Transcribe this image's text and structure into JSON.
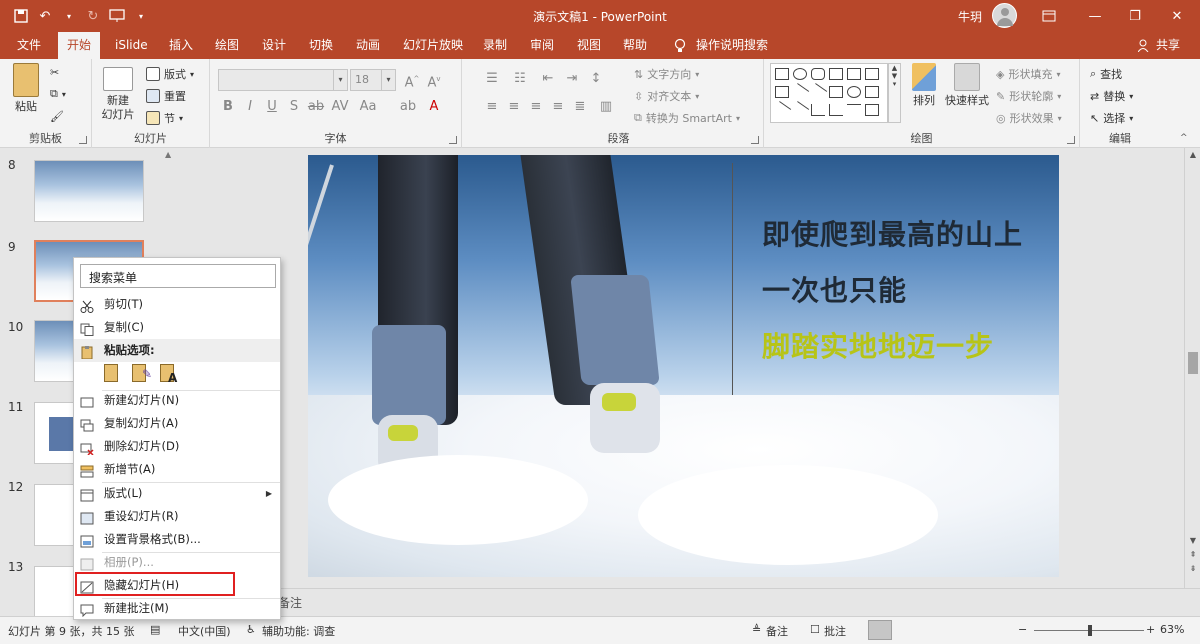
{
  "titlebar": {
    "title": "演示文稿1  -  PowerPoint",
    "user": "牛玥"
  },
  "tabs": [
    "文件",
    "开始",
    "iSlide",
    "插入",
    "绘图",
    "设计",
    "切换",
    "动画",
    "幻灯片放映",
    "录制",
    "审阅",
    "视图",
    "帮助"
  ],
  "tell_me": "操作说明搜索",
  "share": "共享",
  "ribbon": {
    "clipboard": {
      "paste": "粘贴",
      "label": "剪贴板"
    },
    "slides": {
      "new_slide": "新建\n幻灯片",
      "layout": "版式",
      "reset": "重置",
      "section": "节",
      "label": "幻灯片"
    },
    "font": {
      "size": "18",
      "label": "字体"
    },
    "paragraph": {
      "text_dir": "文字方向",
      "align_text": "对齐文本",
      "smartart": "转换为 SmartArt",
      "label": "段落"
    },
    "drawing": {
      "arrange": "排列",
      "quick_styles": "快速样式",
      "fill": "形状填充",
      "outline": "形状轮廓",
      "effects": "形状效果",
      "label": "绘图"
    },
    "editing": {
      "find": "查找",
      "replace": "替换",
      "select": "选择",
      "label": "编辑"
    }
  },
  "thumbnails": {
    "numbers": [
      "8",
      "9",
      "10",
      "11",
      "12",
      "13"
    ]
  },
  "slide": {
    "line1": "即使爬到最高的山上",
    "line2": "一次也只能",
    "line3": "脚踏实地地迈一步",
    "text_color": "#1f2a36",
    "accent_color": "#b7c417"
  },
  "context_menu": {
    "search": "搜索菜单",
    "items": [
      {
        "label": "剪切(T)",
        "icon": "scissors-icon"
      },
      {
        "label": "复制(C)",
        "icon": "copy-icon"
      },
      {
        "label": "粘贴选项:",
        "icon": "paste-icon"
      },
      {
        "label": "新建幻灯片(N)",
        "icon": "new-slide-icon"
      },
      {
        "label": "复制幻灯片(A)",
        "icon": "duplicate-slide-icon"
      },
      {
        "label": "删除幻灯片(D)",
        "icon": "delete-slide-icon"
      },
      {
        "label": "新增节(A)",
        "icon": "add-section-icon"
      },
      {
        "label": "版式(L)",
        "icon": "layout-icon"
      },
      {
        "label": "重设幻灯片(R)",
        "icon": "reset-slide-icon"
      },
      {
        "label": "设置背景格式(B)...",
        "icon": "background-format-icon"
      },
      {
        "label": "相册(P)...",
        "icon": "photo-album-icon"
      },
      {
        "label": "隐藏幻灯片(H)",
        "icon": "hide-slide-icon"
      },
      {
        "label": "新建批注(M)",
        "icon": "new-comment-icon"
      }
    ]
  },
  "notes_label": "备注",
  "statusbar": {
    "slide_info": "幻灯片 第 9 张，共 15 张",
    "language": "中文(中国)",
    "accessibility": "辅助功能: 调查",
    "notes": "备注",
    "comments": "批注",
    "zoom": "63%"
  },
  "colors": {
    "brand": "#b7472a",
    "highlight_box": "#e02020"
  }
}
